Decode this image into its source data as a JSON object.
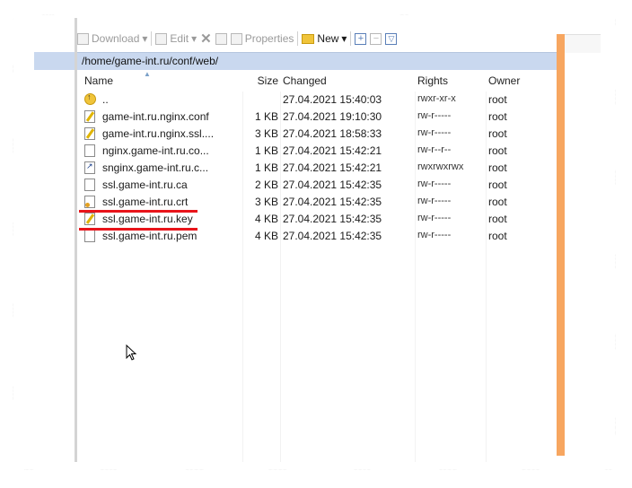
{
  "toolbar": {
    "download": "Download",
    "edit": "Edit",
    "properties": "Properties",
    "new": "New"
  },
  "path": "/home/game-int.ru/conf/web/",
  "columns": {
    "name": "Name",
    "size": "Size",
    "changed": "Changed",
    "rights": "Rights",
    "owner": "Owner"
  },
  "files": [
    {
      "icon": "parent-folder-icon",
      "name": "..",
      "size": "",
      "changed": "27.04.2021 15:40:03",
      "rights": "rwxr-xr-x",
      "owner": "root"
    },
    {
      "icon": "edited-file-icon",
      "name": "game-int.ru.nginx.conf",
      "size": "1 KB",
      "changed": "27.04.2021 19:10:30",
      "rights": "rw-r-----",
      "owner": "root"
    },
    {
      "icon": "edited-file-icon",
      "name": "game-int.ru.nginx.ssl....",
      "size": "3 KB",
      "changed": "27.04.2021 18:58:33",
      "rights": "rw-r-----",
      "owner": "root"
    },
    {
      "icon": "file-icon",
      "name": "nginx.game-int.ru.co...",
      "size": "1 KB",
      "changed": "27.04.2021 15:42:21",
      "rights": "rw-r--r--",
      "owner": "root"
    },
    {
      "icon": "shortcut-file-icon",
      "name": "snginx.game-int.ru.c...",
      "size": "1 KB",
      "changed": "27.04.2021 15:42:21",
      "rights": "rwxrwxrwx",
      "owner": "root"
    },
    {
      "icon": "file-icon",
      "name": "ssl.game-int.ru.ca",
      "size": "2 KB",
      "changed": "27.04.2021 15:42:35",
      "rights": "rw-r-----",
      "owner": "root"
    },
    {
      "icon": "certificate-file-icon",
      "name": "ssl.game-int.ru.crt",
      "size": "3 KB",
      "changed": "27.04.2021 15:42:35",
      "rights": "rw-r-----",
      "owner": "root"
    },
    {
      "icon": "edited-file-icon",
      "name": "ssl.game-int.ru.key",
      "size": "4 KB",
      "changed": "27.04.2021 15:42:35",
      "rights": "rw-r-----",
      "owner": "root"
    },
    {
      "icon": "file-icon",
      "name": "ssl.game-int.ru.pem",
      "size": "4 KB",
      "changed": "27.04.2021 15:42:35",
      "rights": "rw-r-----",
      "owner": "root"
    }
  ],
  "colors": {
    "path_bar": "#c9d8ef",
    "highlight_underline": "#e8141a",
    "panel_accent": "#f7a660"
  }
}
